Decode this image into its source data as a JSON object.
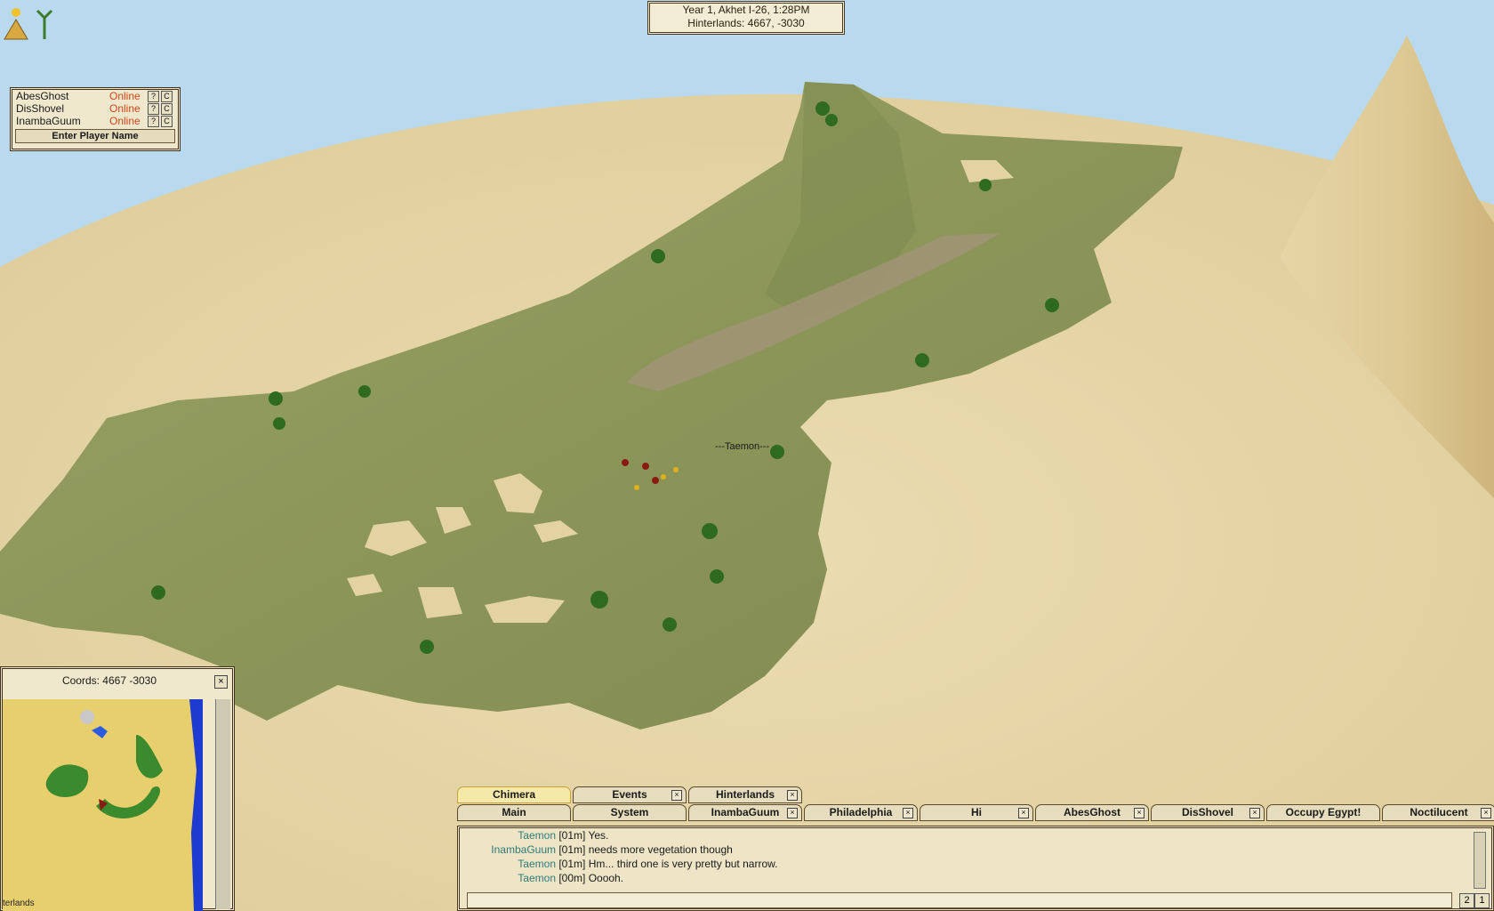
{
  "game": {
    "date_line": "Year 1, Akhet I-26, 1:28PM",
    "location_line": "Hinterlands: 4667, -3030",
    "top_icons": [
      "pyramid-sun-icon",
      "papyrus-plant-icon"
    ]
  },
  "world": {
    "player_label": "---Taemon---"
  },
  "friends": {
    "rows": [
      {
        "name": "AbesGhost",
        "status": "Online",
        "q": "?",
        "c": "C"
      },
      {
        "name": "DisShovel",
        "status": "Online",
        "q": "?",
        "c": "C"
      },
      {
        "name": "InambaGuum",
        "status": "Online",
        "q": "?",
        "c": "C"
      }
    ],
    "enter_player_label": "Enter Player Name"
  },
  "minimap": {
    "coords_label": "Coords: 4667 -3030",
    "close_label": "×",
    "region_label": "terlands"
  },
  "chat": {
    "tabs_top": [
      {
        "label": "Chimera",
        "active": true,
        "close": ""
      },
      {
        "label": "Events",
        "active": false,
        "close": "×"
      },
      {
        "label": "Hinterlands",
        "active": false,
        "close": "×"
      }
    ],
    "tabs_bottom": [
      {
        "label": "Main",
        "close": ""
      },
      {
        "label": "System",
        "close": ""
      },
      {
        "label": "InambaGuum",
        "close": "×"
      },
      {
        "label": "Philadelphia",
        "close": "×"
      },
      {
        "label": "Hi",
        "close": "×"
      },
      {
        "label": "AbesGhost",
        "close": "×"
      },
      {
        "label": "DisShovel",
        "close": "×"
      },
      {
        "label": "Occupy Egypt!",
        "close": ""
      },
      {
        "label": "Noctilucent",
        "close": "×"
      }
    ],
    "lines": [
      {
        "who": "Taemon",
        "time": "[01m]",
        "text": "Yes."
      },
      {
        "who": "InambaGuum",
        "time": "[01m]",
        "text": "needs more vegetation though"
      },
      {
        "who": "Taemon",
        "time": "[01m]",
        "text": "Hm... third one is very pretty but narrow."
      },
      {
        "who": "Taemon",
        "time": "[00m]",
        "text": "Ooooh."
      }
    ],
    "input_value": "",
    "page_buttons": [
      "2",
      "1"
    ]
  },
  "colors": {
    "sky": "#b9d9ee",
    "sand": "#e7d7a8",
    "grass": "#8b9657",
    "online": "#d2451a",
    "chat_name": "#2e7a7a"
  }
}
